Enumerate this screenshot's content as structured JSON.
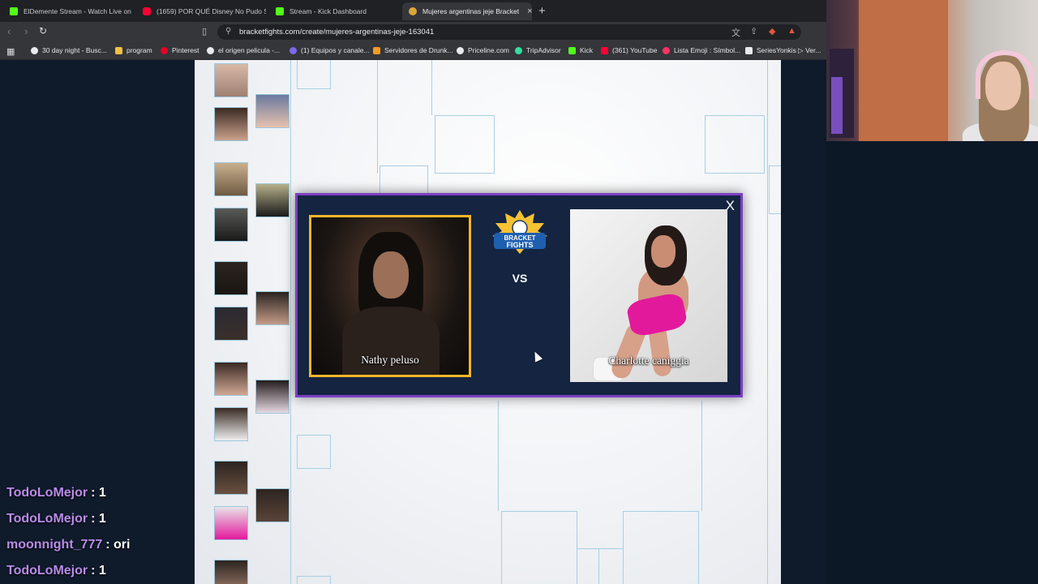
{
  "browser": {
    "tabs": [
      {
        "title": "ElDemente Stream - Watch Live on K",
        "favicon": "kick-icon",
        "active": false
      },
      {
        "title": "(1659) POR QUÉ Disney No Pudo Sal",
        "favicon": "youtube-icon",
        "active": false
      },
      {
        "title": "Stream - Kick Dashboard",
        "favicon": "kick-icon",
        "active": false
      },
      {
        "title": "Mujeres argentinas jeje Bracket",
        "favicon": "bracketfights-icon",
        "active": true
      }
    ],
    "tab_close": "×",
    "new_tab": "+",
    "url": "bracketfights.com/create/mujeres-argentinas-jeje-163041",
    "bookmarks": [
      {
        "label": "30 day night - Busc...",
        "color": "#e8eaed"
      },
      {
        "label": "program",
        "color": "#f2c043"
      },
      {
        "label": "Pinterest",
        "color": "#e60023"
      },
      {
        "label": "el origen pelicula -...",
        "color": "#e8eaed"
      },
      {
        "label": "(1) Equipos y canale...",
        "color": "#7b68ee"
      },
      {
        "label": "Servidores de Drunk...",
        "color": "#f59a23"
      },
      {
        "label": "Priceline.com",
        "color": "#e8eaed"
      },
      {
        "label": "TripAdvisor",
        "color": "#34e0a1"
      },
      {
        "label": "Kick",
        "color": "#53fc18"
      },
      {
        "label": "(361) YouTube",
        "color": "#ff0033"
      },
      {
        "label": "Lista Emoji : Símbol...",
        "color": "#ff3366"
      },
      {
        "label": "SeriesYonkis ▷ Ver...",
        "color": "#e8eaed"
      }
    ]
  },
  "modal": {
    "close_label": "X",
    "vs_label": "VS",
    "logo_text_top": "BRACKET",
    "logo_text_bottom": "FIGHTS",
    "left": {
      "name": "Nathy peluso",
      "border_color": "#f2b62a"
    },
    "right": {
      "name": "Charlotte caniggia"
    },
    "border_color": "#7c3fc4"
  },
  "chat": [
    {
      "user": "TodoLoMejor",
      "message": ": 1"
    },
    {
      "user": "TodoLoMejor",
      "message": ": 1"
    },
    {
      "user": "moonnight_777",
      "message": ": ori"
    },
    {
      "user": "TodoLoMejor",
      "message": ": 1"
    }
  ],
  "colors": {
    "bracket_line": "#a9cfe2",
    "chat_username": "#b98ce8",
    "page_background": "#0f1a2b"
  }
}
